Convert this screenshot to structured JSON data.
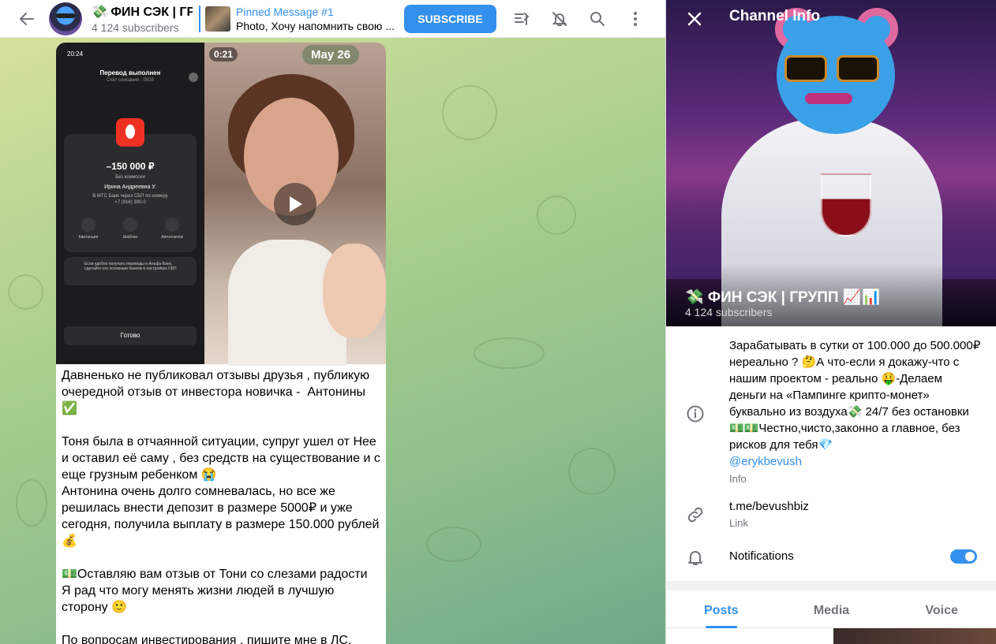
{
  "header": {
    "title": "💸 ФИН СЭК | ГР",
    "subscribers": "4 124 subscribers",
    "pinned_title": "Pinned Message #1",
    "pinned_text": "Photo, Хочу напомнить свою ...",
    "subscribe_label": "SUBSCRIBE"
  },
  "message": {
    "video_duration": "0:21",
    "date": "May 26",
    "phone": {
      "time": "20:24",
      "title": "Перевод выполнен",
      "subtitle": "Счёт списания ··0915",
      "amount": "–150 000 ₽",
      "no_fee": "Без комиссии",
      "recipient": "Ирина Андреевна У.",
      "via": "В МТС Банк через СБП по номеру",
      "phone_number": "+7 (916) 390-0",
      "actions": [
        "Квитанция",
        "Шаблон",
        "Автоплатёж"
      ],
      "note": "Если удобно получать переводы в Альфа-Банк, сделайте его основным банком в настройках СБП",
      "done": "Готово"
    },
    "text": "Давненько не публиковал отзывы друзья , публикую очередной отзыв от инвестора новичка -  Антонины ✅\n\nТоня была в отчаянной ситуации, супруг ушел от Нее и оставил её саму , без средств на существование и с еще грузным ребенком 😭\nАнтонина очень долго сомневалась, но все же решилась внести депозит в размере 5000₽ и уже сегодня, получила выплату в размере 150.000 рублей 💰\n\n💵Оставляю вам отзыв от Тони со слезами радости\nЯ рад что могу менять жизни людей в лучшую сторону 🙂\n\nПо вопросам инвестирования , пишите мне в ЛС."
  },
  "panel": {
    "title": "Channel Info",
    "channel_name": "💸 ФИН СЭК | ГРУПП 📈📊",
    "subscribers": "4 124 subscribers",
    "description": "Зарабатывать в сутки от 100.000 до 500.000₽ нереально ? 🤔А что-если я докажу-что с нашим проектом - реально 🤑-Делаем деньги на «Пампинге крипто-монет» буквально из воздуха💸 24/7 без остановки💵💵Честно,чисто,законно а главное, без рисков для тебя💎",
    "mention": "@erykbevush",
    "info_label": "Info",
    "link": "t.me/bevushbiz",
    "link_label": "Link",
    "notifications_label": "Notifications",
    "notifications_on": true,
    "tabs": [
      "Posts",
      "Media",
      "Voice"
    ]
  },
  "icons": [
    "back-arrow-icon",
    "filter-icon",
    "mute-icon",
    "search-icon",
    "more-icon",
    "close-icon",
    "info-icon",
    "link-icon",
    "bell-icon",
    "play-icon"
  ],
  "colors": {
    "accent": "#3390ec",
    "secondary_text": "#707579"
  }
}
